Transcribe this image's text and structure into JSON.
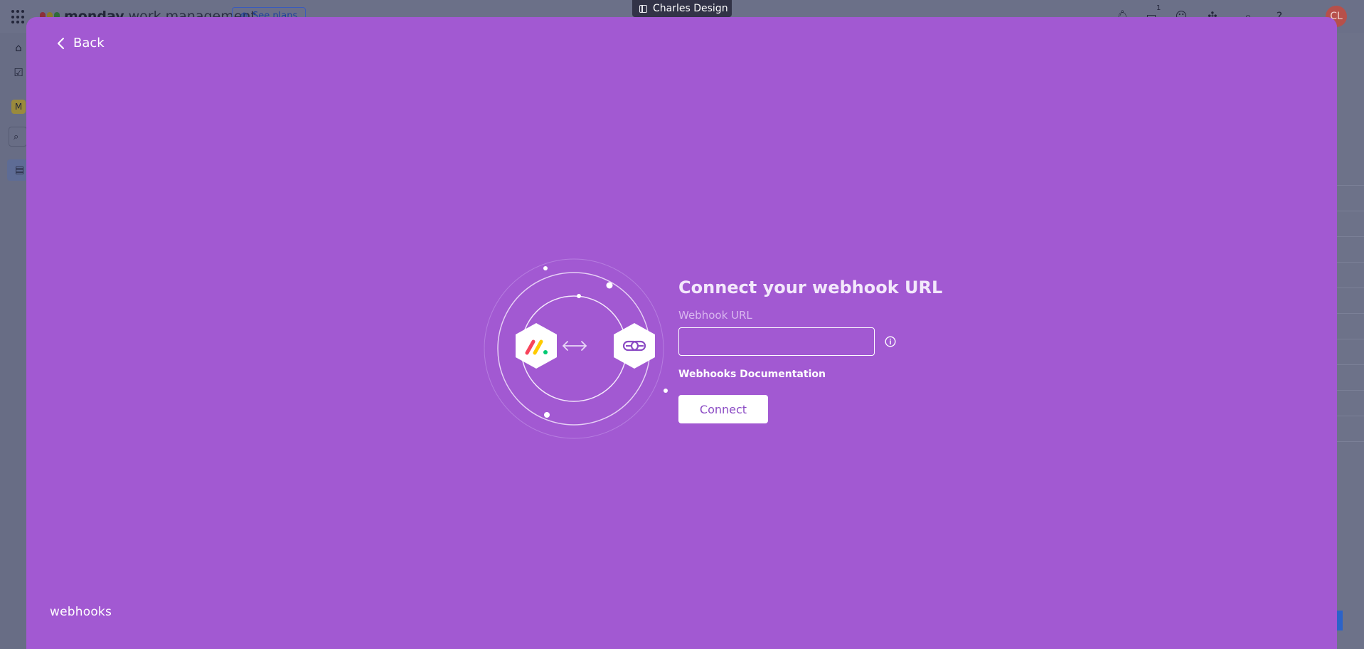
{
  "background_app": {
    "brand_name": "monday",
    "brand_suffix": "work management",
    "plans_button": "See plans",
    "notification_count": "1",
    "avatar_initials": "CL",
    "workspace_initial": "M"
  },
  "tab": {
    "title": "Charles Design"
  },
  "modal": {
    "back_label": "Back",
    "title": "Connect your webhook URL",
    "url_label": "Webhook URL",
    "url_value": "",
    "url_placeholder": "",
    "docs_link": "Webhooks Documentation",
    "connect_label": "Connect",
    "footer_logo": "webhooks"
  },
  "colors": {
    "modal_background": "#a259d2",
    "button_text": "#8b4bc4",
    "overlay": "#6a6f86"
  }
}
